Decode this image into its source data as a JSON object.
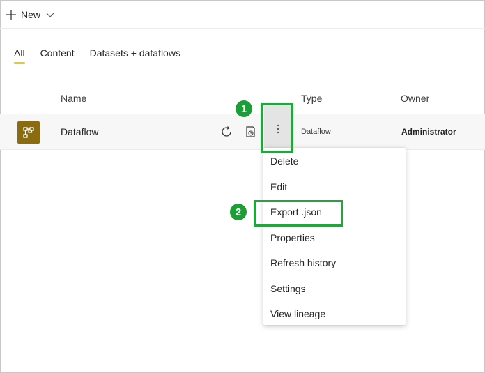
{
  "toolbar": {
    "new_label": "New"
  },
  "tabs": [
    {
      "label": "All",
      "active": true
    },
    {
      "label": "Content",
      "active": false
    },
    {
      "label": "Datasets + dataflows",
      "active": false
    }
  ],
  "table": {
    "headers": {
      "name": "Name",
      "type": "Type",
      "owner": "Owner"
    },
    "rows": [
      {
        "name": "Dataflow",
        "type": "Dataflow",
        "owner": "Administrator",
        "icon": "dataflow-icon"
      }
    ]
  },
  "context_menu": {
    "items": [
      "Delete",
      "Edit",
      "Export .json",
      "Properties",
      "Refresh history",
      "Settings",
      "View lineage"
    ]
  },
  "callouts": {
    "step1": "1",
    "step2": "2"
  },
  "colors": {
    "accent_tab": "#f2c811",
    "dataflow_icon_bg": "#8a6b0e",
    "callout_green": "#1ea83a"
  }
}
